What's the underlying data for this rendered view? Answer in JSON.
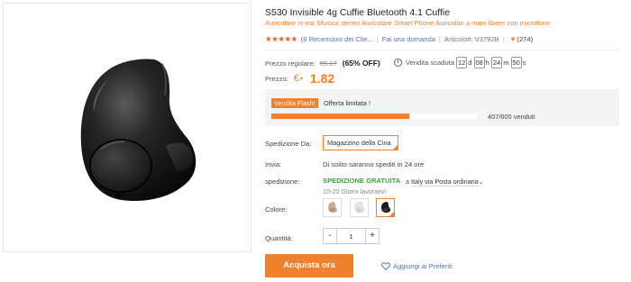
{
  "product": {
    "title": "S530 Invisible 4g Cuffie Bluetooth 4.1 Cuffie",
    "subtitle": "Auricolare in-ear Musica stereo Auricolare Smart Phone Auricolari a mani libere con microfono"
  },
  "rating": {
    "stars": "★★★★★",
    "reviews_link": "(8 Recensioni dei Clie...",
    "ask_link": "Fai una domanda",
    "article": "Articolo#: V3792B",
    "favorites_count": "(274)",
    "separator": "|"
  },
  "pricing": {
    "regular_label": "Prezzo regolare:",
    "regular_price": "€5.17",
    "discount": "(65% OFF)",
    "price_label": "Prezzo:",
    "currency": "€",
    "currency_caret": "▾",
    "current_price": "1.82"
  },
  "sale_timer": {
    "label": "Vendita scaduta",
    "days": "12",
    "days_unit": "d",
    "hours": "08",
    "hours_unit": "h",
    "minutes": "24",
    "minutes_unit": "m",
    "seconds": "50",
    "seconds_unit": "s"
  },
  "flash_sale": {
    "badge": "Vendita Flash!",
    "text": "Offerta limitata !",
    "sold_text": "407/605 venduti",
    "sold_fraction": 0.673
  },
  "shipping": {
    "ship_from_label": "Spedizione Da:",
    "warehouse": "Magazzino della Cina",
    "send_label": "Invia:",
    "send_value": "Di solito saranno spediti in 24 ore",
    "shipping_label": "spedizione:",
    "free_shipping": "SPEDIZIONE GRATUITA",
    "to_prefix": "a",
    "destination": "Italy via Posta ordinaria",
    "dropdown_caret": "⌄",
    "delivery_days": "10-20 Giorni lavorativi"
  },
  "options": {
    "color_label": "Colore:",
    "colors": [
      {
        "name": "beige",
        "hex": "#c9ad8c"
      },
      {
        "name": "white",
        "hex": "#e6e6e6"
      },
      {
        "name": "black",
        "hex": "#1a1a1a"
      }
    ],
    "selected_color": "black",
    "quantity_label": "Quantità:",
    "quantity": "1",
    "minus": "-",
    "plus": "+"
  },
  "actions": {
    "buy": "Acquista ora",
    "wishlist": "Aggiungi ai Preferiti"
  },
  "colors": {
    "accent": "#f0812d",
    "link": "#5a72b6",
    "success": "#3aa13c"
  }
}
